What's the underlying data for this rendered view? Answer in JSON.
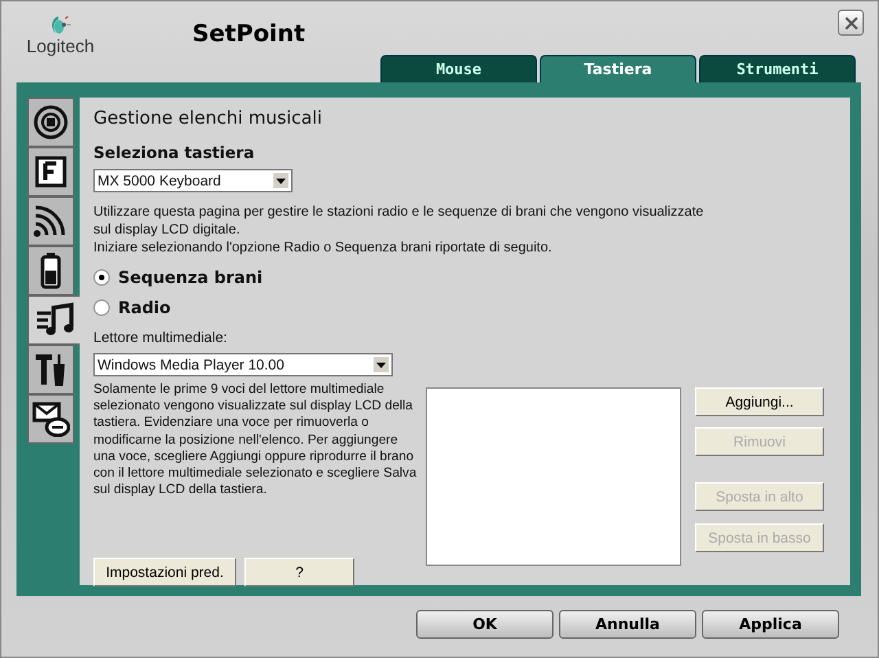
{
  "window": {
    "logo": "Logitech",
    "title": "SetPoint"
  },
  "tabs": [
    {
      "label": "Mouse",
      "selected": false
    },
    {
      "label": "Tastiera",
      "selected": true
    },
    {
      "label": "Strumenti",
      "selected": false
    }
  ],
  "sidebar": {
    "items": [
      {
        "kind": "disc",
        "selected": false
      },
      {
        "kind": "fkey",
        "selected": false
      },
      {
        "kind": "signal",
        "selected": false
      },
      {
        "kind": "battery",
        "selected": false
      },
      {
        "kind": "music",
        "selected": true
      },
      {
        "kind": "tools",
        "selected": false
      },
      {
        "kind": "mail",
        "selected": false
      }
    ]
  },
  "page": {
    "heading": "Gestione elenchi musicali",
    "keyboard_label": "Seleziona tastiera",
    "keyboard_select": {
      "value": "MX 5000 Keyboard"
    },
    "intro": [
      "Utilizzare questa pagina per gestire le stazioni radio e le sequenze di brani che vengono visualizzate sul display LCD digitale.",
      "Iniziare selezionando l'opzione Radio o Sequenza brani riportate di seguito."
    ],
    "modes": [
      {
        "label": "Sequenza brani",
        "selected": true
      },
      {
        "label": "Radio",
        "selected": false
      }
    ],
    "player_label": "Lettore multimediale:",
    "player_select": {
      "value": "Windows Media Player 10.00"
    },
    "help": "Solamente le prime 9 voci del lettore multimediale selezionato vengono visualizzate sul display LCD della tastiera. Evidenziare una voce per rimuoverla o modificarne la posizione nell'elenco. Per aggiungere una voce, scegliere Aggiungi oppure riprodurre il brano con il lettore multimediale selezionato e scegliere Salva sul display LCD della tastiera.",
    "list_buttons": [
      {
        "label": "Aggiungi...",
        "disabled": false
      },
      {
        "label": "Rimuovi",
        "disabled": true
      },
      {
        "label": "Sposta in alto",
        "disabled": true
      },
      {
        "label": "Sposta in basso",
        "disabled": true
      }
    ],
    "footer_buttons": [
      "Impostazioni pred.",
      "?"
    ]
  },
  "buttons": [
    "OK",
    "Annulla",
    "Applica"
  ]
}
